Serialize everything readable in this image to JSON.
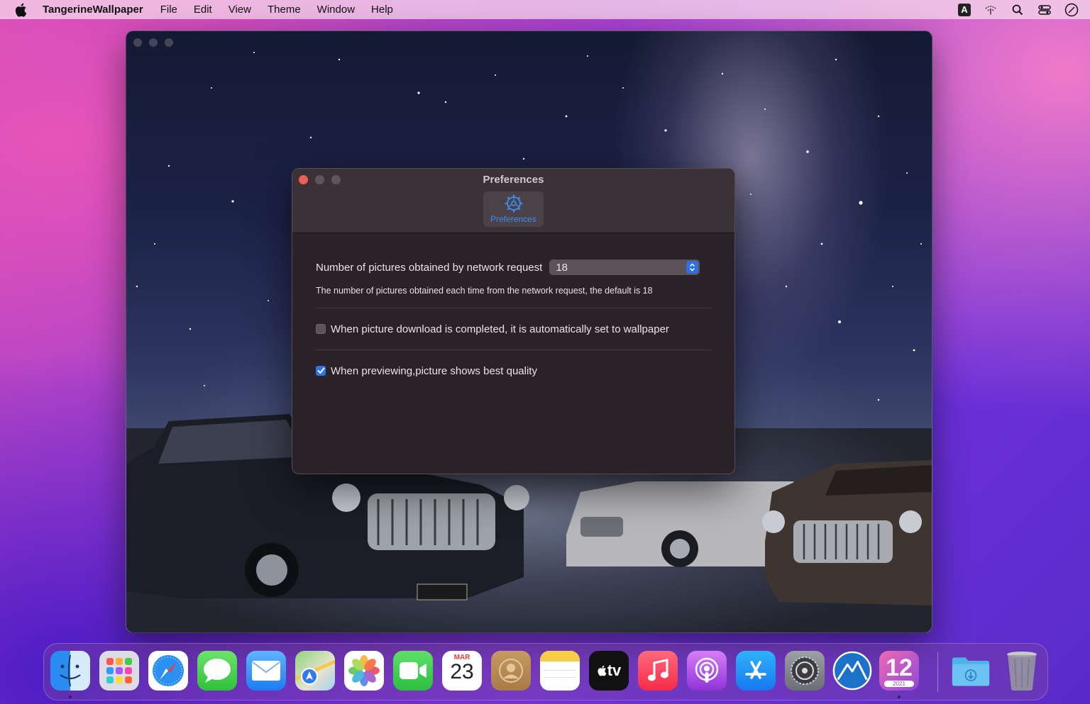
{
  "menubar": {
    "app_name": "TangerineWallpaper",
    "menus": [
      "File",
      "Edit",
      "View",
      "Theme",
      "Window",
      "Help"
    ],
    "input_badge": "A"
  },
  "preferences": {
    "title": "Preferences",
    "tab_label": "Preferences",
    "count_label": "Number of pictures obtained by network request",
    "count_value": "18",
    "count_hint": "The number of pictures obtained each time from the network request, the default is 18",
    "auto_set_label": "When picture download is completed, it is automatically set to wallpaper",
    "auto_set_checked": false,
    "best_quality_label": "When previewing,picture shows best quality",
    "best_quality_checked": true,
    "accent_color": "#2f74e8"
  },
  "dock": {
    "calendar_month": "MAR",
    "calendar_day": "23",
    "tv_label": "tv",
    "monterey_number": "12",
    "monterey_year": "2021",
    "apps": [
      "finder-icon",
      "launchpad-icon",
      "safari-icon",
      "messages-icon",
      "mail-icon",
      "maps-icon",
      "photos-icon",
      "facetime-icon",
      "calendar-icon",
      "contacts-icon",
      "notes-icon",
      "apple-tv-icon",
      "music-icon",
      "podcasts-icon",
      "app-store-icon",
      "system-preferences-icon",
      "tangerine-wallpaper-icon",
      "macos-monterey-icon",
      "downloads-folder-icon",
      "trash-icon"
    ]
  }
}
